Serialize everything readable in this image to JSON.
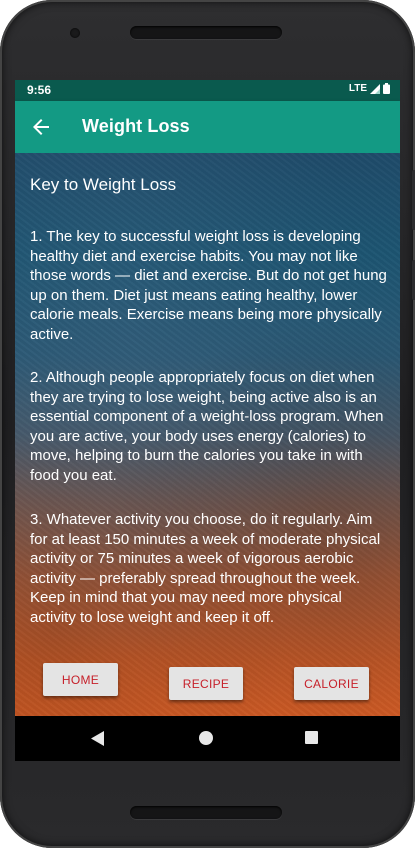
{
  "status": {
    "time": "9:56",
    "network": "LTE"
  },
  "appbar": {
    "title": "Weight Loss",
    "back_icon": "arrow-left-icon"
  },
  "content": {
    "heading": "Key to Weight Loss",
    "paragraphs": [
      "1. The key to successful weight loss is developing healthy diet and exercise habits. You may not like those words — diet and exercise. But do not get hung up on them. Diet just means eating healthy, lower calorie meals. Exercise means being more physically active.",
      "2. Although people appropriately focus on diet when they are trying to lose weight, being active also is an essential component of a weight-loss program. When you are active, your body uses energy (calories) to move, helping to burn the calories you take in with food you eat.",
      "3. Whatever activity you choose, do it regularly. Aim for at least 150 minutes a week of moderate physical activity or 75 minutes a week of vigorous aerobic activity — preferably spread throughout the week. Keep in mind that you may need more physical activity to lose weight and keep it off."
    ]
  },
  "buttons": {
    "home": "HOME",
    "recipe": "RECIPE",
    "calorie": "CALORIE"
  },
  "colors": {
    "status_bar": "#0a5a4e",
    "app_bar": "#139a84",
    "button_text": "#c6202a"
  }
}
